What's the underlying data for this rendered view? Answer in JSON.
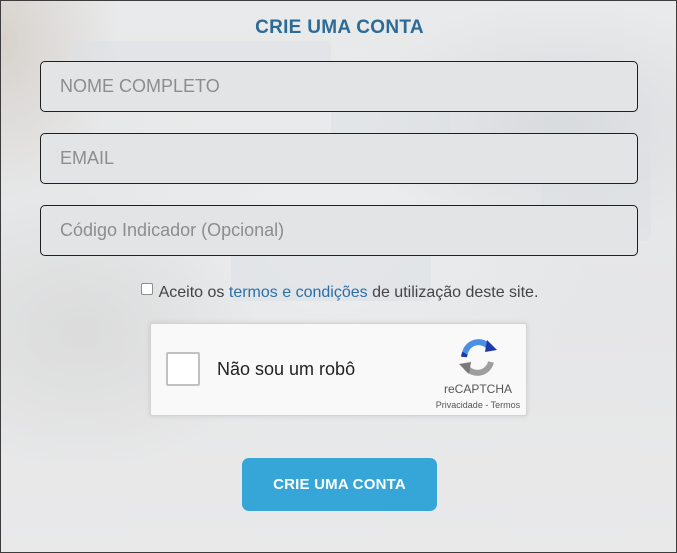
{
  "form": {
    "title": "CRIE UMA CONTA",
    "fields": {
      "name_placeholder": "NOME COMPLETO",
      "email_placeholder": "EMAIL",
      "referral_placeholder": "Código Indicador (Opcional)"
    },
    "terms": {
      "prefix": "Aceito os",
      "link": "termos e condições",
      "suffix": "de utilização deste site.",
      "checked": false
    },
    "recaptcha": {
      "label": "Não sou um robô",
      "brand": "reCAPTCHA",
      "privacy": "Privacidade",
      "separator": " - ",
      "terms": "Termos",
      "icon": "recaptcha-logo-icon"
    },
    "submit_label": "CRIE UMA CONTA"
  },
  "colors": {
    "title": "#2d6a96",
    "link": "#2c6fa6",
    "button": "#36a6d9"
  }
}
